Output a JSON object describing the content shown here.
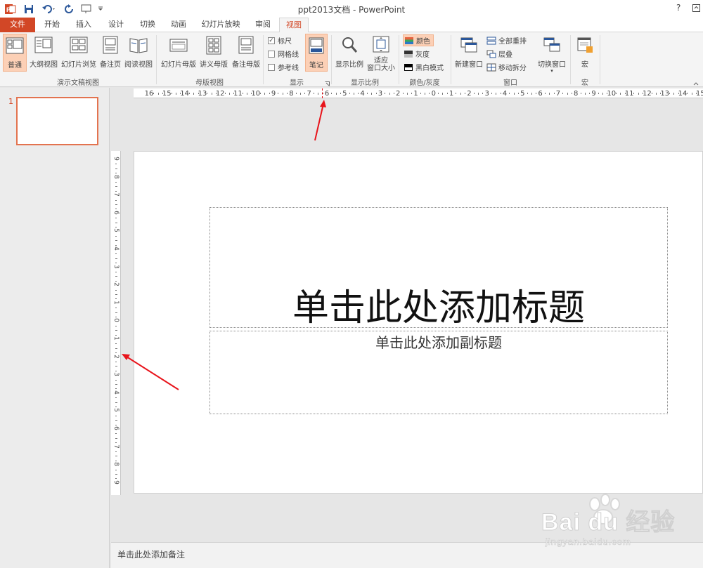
{
  "window": {
    "title": "ppt2013文档 - PowerPoint",
    "help": "?"
  },
  "tabs": [
    {
      "label": "文件",
      "state": "file"
    },
    {
      "label": "开始",
      "state": ""
    },
    {
      "label": "插入",
      "state": ""
    },
    {
      "label": "设计",
      "state": ""
    },
    {
      "label": "切换",
      "state": ""
    },
    {
      "label": "动画",
      "state": ""
    },
    {
      "label": "幻灯片放映",
      "state": ""
    },
    {
      "label": "审阅",
      "state": ""
    },
    {
      "label": "视图",
      "state": "active"
    }
  ],
  "ribbon": {
    "presentation_views": {
      "label": "演示文稿视图",
      "buttons": [
        {
          "label": "普通",
          "selected": true
        },
        {
          "label": "大纲视图",
          "selected": false
        },
        {
          "label": "幻灯片浏览",
          "selected": false
        },
        {
          "label": "备注页",
          "selected": false
        },
        {
          "label": "阅读视图",
          "selected": false
        }
      ]
    },
    "master_views": {
      "label": "母版视图",
      "buttons": [
        {
          "label": "幻灯片母版"
        },
        {
          "label": "讲义母版"
        },
        {
          "label": "备注母版"
        }
      ]
    },
    "show": {
      "label": "显示",
      "checks": [
        {
          "label": "标尺",
          "checked": true
        },
        {
          "label": "网格线",
          "checked": false
        },
        {
          "label": "参考线",
          "checked": false
        }
      ],
      "notes_label": "笔记"
    },
    "zoom": {
      "label": "显示比例",
      "zoom_label": "显示比例",
      "fit_label_1": "适应",
      "fit_label_2": "窗口大小"
    },
    "color": {
      "label": "颜色/灰度",
      "items": [
        {
          "label": "颜色",
          "selected": true
        },
        {
          "label": "灰度",
          "selected": false
        },
        {
          "label": "黑白模式",
          "selected": false
        }
      ]
    },
    "window_group": {
      "label": "窗口",
      "new_window": "新建窗口",
      "items": [
        {
          "label": "全部重排"
        },
        {
          "label": "层叠"
        },
        {
          "label": "移动拆分"
        }
      ],
      "switch": "切换窗口"
    },
    "macros": {
      "label": "宏",
      "button": "宏"
    }
  },
  "hruler_ticks": [
    "16",
    "15",
    "14",
    "13",
    "12",
    "11",
    "10",
    "9",
    "8",
    "7",
    "6",
    "5",
    "4",
    "3",
    "2",
    "1",
    "0",
    "1",
    "2",
    "3",
    "4",
    "5",
    "6",
    "7",
    "8",
    "9",
    "10",
    "11",
    "12",
    "13",
    "14",
    "15"
  ],
  "vruler_ticks": [
    "9",
    "8",
    "7",
    "6",
    "5",
    "4",
    "3",
    "2",
    "1",
    "0",
    "1",
    "2",
    "3",
    "4",
    "5",
    "6",
    "7",
    "8",
    "9"
  ],
  "thumbnails": [
    {
      "number": "1"
    }
  ],
  "slide": {
    "title_placeholder": "单击此处添加标题",
    "subtitle_placeholder": "单击此处添加副标题"
  },
  "notes_placeholder": "单击此处添加备注",
  "watermark": {
    "brand": "Bai du 经验",
    "url": "jingyan.baidu.com"
  },
  "colors": {
    "accent": "#d24726",
    "selected_fill": "#fcd0b6",
    "arrow": "#e8141b"
  }
}
